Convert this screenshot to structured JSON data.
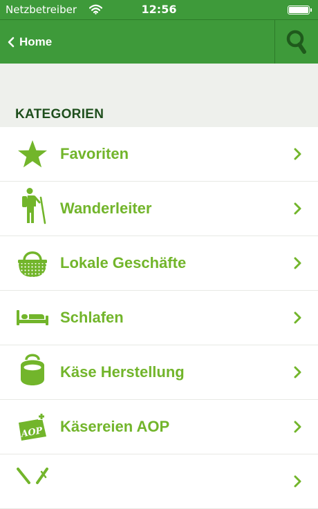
{
  "status_bar": {
    "carrier": "Netzbetreiber",
    "time": "12:56"
  },
  "nav": {
    "back_label": "Home"
  },
  "section": {
    "title": "KATEGORIEN"
  },
  "categories": [
    {
      "label": "Favoriten",
      "icon": "star-icon"
    },
    {
      "label": "Wanderleiter",
      "icon": "hiker-icon"
    },
    {
      "label": "Lokale Geschäfte",
      "icon": "basket-icon"
    },
    {
      "label": "Schlafen",
      "icon": "bed-icon"
    },
    {
      "label": "Käse Herstellung",
      "icon": "cheese-pot-icon"
    },
    {
      "label": "Käsereien AOP",
      "icon": "aop-label-icon"
    },
    {
      "label": "",
      "icon": "cutlery-icon"
    }
  ],
  "colors": {
    "primary": "#3e9a3a",
    "accent": "#72b52b",
    "heading": "#1f4f1d",
    "background": "#eef0ec"
  }
}
